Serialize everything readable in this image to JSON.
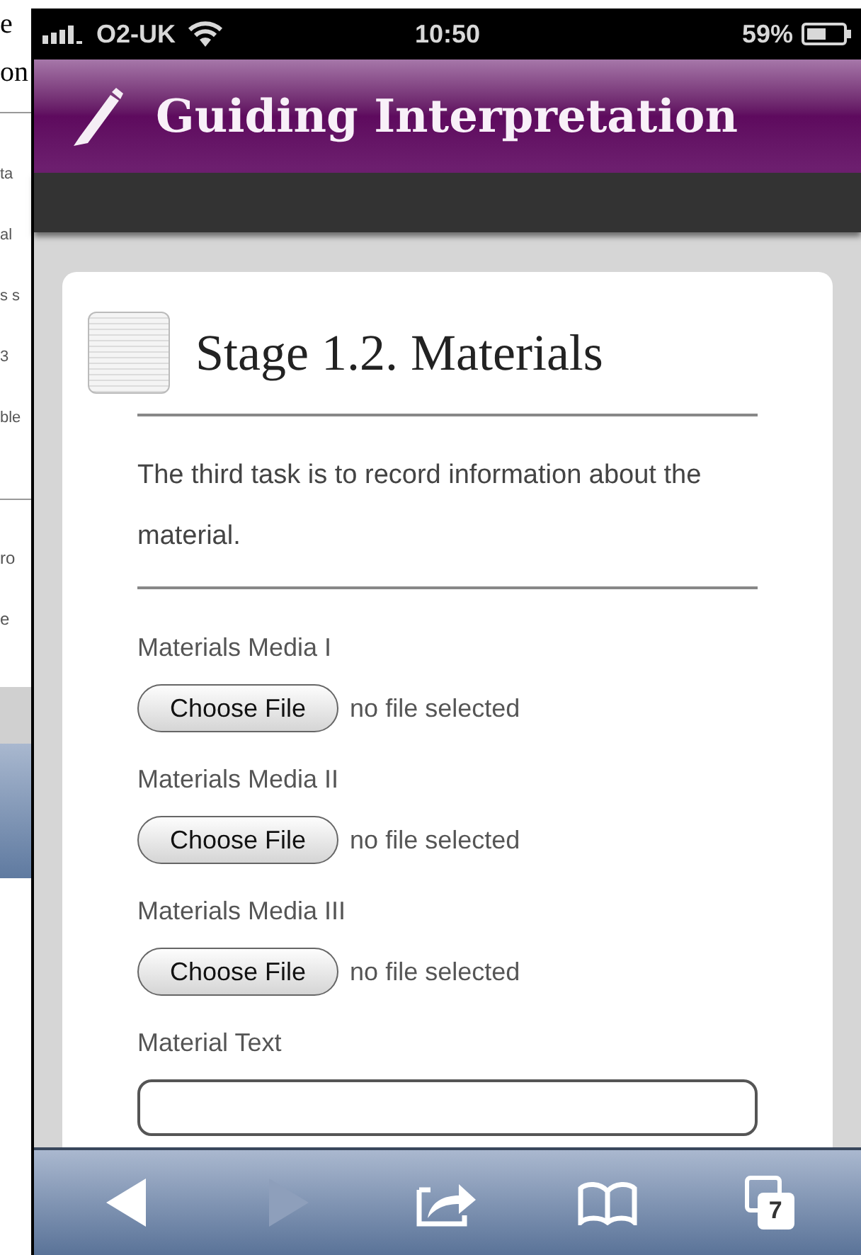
{
  "background_page": {
    "heading": [
      "e",
      "on"
    ],
    "lines": [
      "ta",
      "al",
      "s s",
      "3",
      "ble"
    ],
    "lines_2": [
      "ro",
      "e"
    ]
  },
  "status_bar": {
    "carrier": "O2-UK",
    "time": "10:50",
    "battery": "59%"
  },
  "header": {
    "title": "Guiding Interpretation"
  },
  "card": {
    "title": "Stage 1.2. Materials",
    "intro": "The third task is to record information about the material.",
    "fields": [
      {
        "kind": "file",
        "label": "Materials Media I",
        "button": "Choose File",
        "status": "no file selected"
      },
      {
        "kind": "file",
        "label": "Materials Media II",
        "button": "Choose File",
        "status": "no file selected"
      },
      {
        "kind": "file",
        "label": "Materials Media III",
        "button": "Choose File",
        "status": "no file selected"
      },
      {
        "kind": "text",
        "label": "Material Text"
      }
    ]
  },
  "toolbar": {
    "buttons": [
      {
        "kind": "back",
        "disabled": false
      },
      {
        "kind": "forward",
        "disabled": true
      },
      {
        "kind": "share",
        "disabled": false
      },
      {
        "kind": "bookmarks",
        "disabled": false
      },
      {
        "kind": "tabs",
        "disabled": false,
        "count": "7"
      }
    ]
  }
}
